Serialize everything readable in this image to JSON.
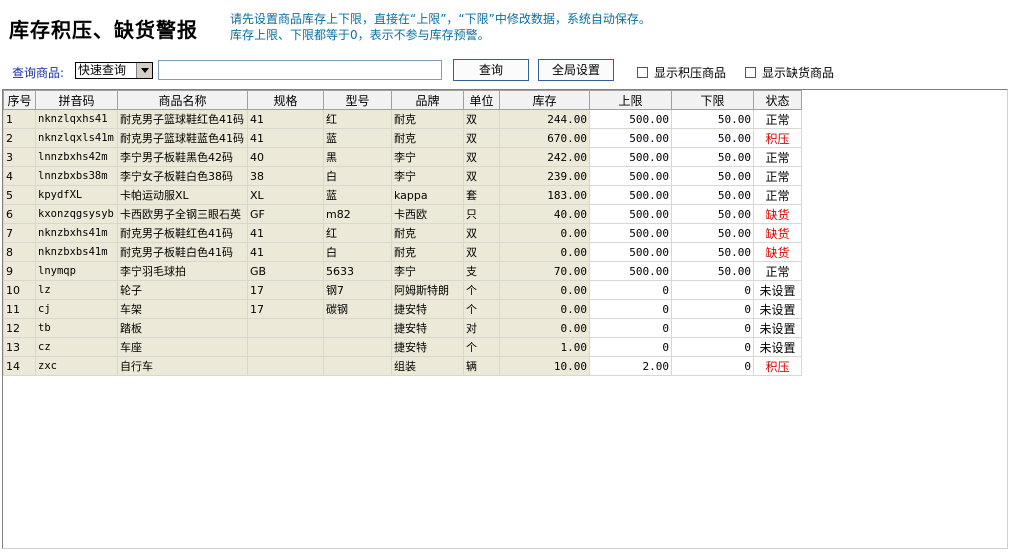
{
  "title": "库存积压、缺货警报",
  "notice": {
    "line1": "请先设置商品库存上下限，直接在“上限”，“下限”中修改数据，系统自动保存。",
    "line2": "库存上限、下限都等于0，表示不参与库存预警。"
  },
  "toolbar": {
    "query_label": "查询商品:",
    "select_value": "快速查询",
    "search_value": "",
    "query_button": "查询",
    "global_button": "全局设置",
    "show_overstock": "显示积压商品",
    "show_shortage": "显示缺货商品"
  },
  "table": {
    "columns": [
      "序号",
      "拼音码",
      "商品名称",
      "规格",
      "型号",
      "品牌",
      "单位",
      "库存",
      "上限",
      "下限",
      "状态"
    ],
    "rows": [
      {
        "no": "1",
        "code": "nknzlqxhs41",
        "name": "耐克男子篮球鞋红色41码",
        "spec": "41",
        "model": "红",
        "brand": "耐克",
        "unit": "双",
        "stock": "244.00",
        "upper": "500.00",
        "lower": "50.00",
        "status": "正常",
        "alert": false
      },
      {
        "no": "2",
        "code": "nknzlqxls41m",
        "name": "耐克男子篮球鞋蓝色41码",
        "spec": "41",
        "model": "蓝",
        "brand": "耐克",
        "unit": "双",
        "stock": "670.00",
        "upper": "500.00",
        "lower": "50.00",
        "status": "积压",
        "alert": true
      },
      {
        "no": "3",
        "code": "lnnzbxhs42m",
        "name": "李宁男子板鞋黑色42码",
        "spec": "40",
        "model": "黑",
        "brand": "李宁",
        "unit": "双",
        "stock": "242.00",
        "upper": "500.00",
        "lower": "50.00",
        "status": "正常",
        "alert": false
      },
      {
        "no": "4",
        "code": "lnnzbxbs38m",
        "name": "李宁女子板鞋白色38码",
        "spec": "38",
        "model": "白",
        "brand": "李宁",
        "unit": "双",
        "stock": "239.00",
        "upper": "500.00",
        "lower": "50.00",
        "status": "正常",
        "alert": false
      },
      {
        "no": "5",
        "code": "kpydfXL",
        "name": "卡帕运动服XL",
        "spec": "XL",
        "model": "蓝",
        "brand": "kappa",
        "unit": "套",
        "stock": "183.00",
        "upper": "500.00",
        "lower": "50.00",
        "status": "正常",
        "alert": false
      },
      {
        "no": "6",
        "code": "kxonzqgsysyb",
        "name": "卡西欧男子全钢三眼石英",
        "spec": "GF",
        "model": "m82",
        "brand": "卡西欧",
        "unit": "只",
        "stock": "40.00",
        "upper": "500.00",
        "lower": "50.00",
        "status": "缺货",
        "alert": true
      },
      {
        "no": "7",
        "code": "nknzbxhs41m",
        "name": "耐克男子板鞋红色41码",
        "spec": "41",
        "model": "红",
        "brand": "耐克",
        "unit": "双",
        "stock": "0.00",
        "upper": "500.00",
        "lower": "50.00",
        "status": "缺货",
        "alert": true
      },
      {
        "no": "8",
        "code": "nknzbxbs41m",
        "name": "耐克男子板鞋白色41码",
        "spec": "41",
        "model": "白",
        "brand": "耐克",
        "unit": "双",
        "stock": "0.00",
        "upper": "500.00",
        "lower": "50.00",
        "status": "缺货",
        "alert": true
      },
      {
        "no": "9",
        "code": "lnymqp",
        "name": "李宁羽毛球拍",
        "spec": "GB",
        "model": "5633",
        "brand": "李宁",
        "unit": "支",
        "stock": "70.00",
        "upper": "500.00",
        "lower": "50.00",
        "status": "正常",
        "alert": false
      },
      {
        "no": "10",
        "code": "lz",
        "name": "轮子",
        "spec": "17",
        "model": "钢7",
        "brand": "阿姆斯特朗",
        "unit": "个",
        "stock": "0.00",
        "upper": "0",
        "lower": "0",
        "status": "未设置",
        "alert": false
      },
      {
        "no": "11",
        "code": "cj",
        "name": "车架",
        "spec": "17",
        "model": "碳钢",
        "brand": "捷安特",
        "unit": "个",
        "stock": "0.00",
        "upper": "0",
        "lower": "0",
        "status": "未设置",
        "alert": false
      },
      {
        "no": "12",
        "code": "tb",
        "name": "踏板",
        "spec": "",
        "model": "",
        "brand": "捷安特",
        "unit": "对",
        "stock": "0.00",
        "upper": "0",
        "lower": "0",
        "status": "未设置",
        "alert": false
      },
      {
        "no": "13",
        "code": "cz",
        "name": "车座",
        "spec": "",
        "model": "",
        "brand": "捷安特",
        "unit": "个",
        "stock": "1.00",
        "upper": "0",
        "lower": "0",
        "status": "未设置",
        "alert": false
      },
      {
        "no": "14",
        "code": "zxc",
        "name": "自行车",
        "spec": "",
        "model": "",
        "brand": "组装",
        "unit": "辆",
        "stock": "10.00",
        "upper": "2.00",
        "lower": "0",
        "status": "积压",
        "alert": true
      }
    ]
  },
  "colors": {
    "notice": "#0b6e9e",
    "alert": "#e00000",
    "cell_bg": "#ece9d8"
  }
}
